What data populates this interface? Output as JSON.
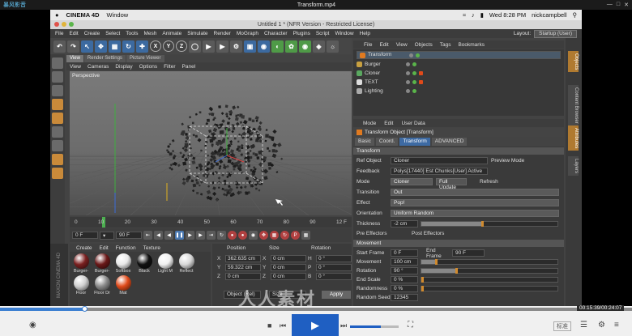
{
  "player": {
    "brand": "暴风影音",
    "title": "Transform.mp4",
    "window_controls": [
      "—",
      "□",
      "✕"
    ],
    "time": "00:15:39/00:24:07",
    "quality": "标准",
    "seek_progress": 0.133,
    "volume": 0.63
  },
  "mac_menu": {
    "app": "CINEMA 4D",
    "items": [
      "Window"
    ],
    "clock": "Wed 8:28 PM",
    "user": "nickcampbell"
  },
  "c4d": {
    "title": "Untitled 1 * (NFR Version - Restricted License)",
    "menu": [
      "File",
      "Edit",
      "Create",
      "Select",
      "Tools",
      "Mesh",
      "Animate",
      "Simulate",
      "Render",
      "MoGraph",
      "Character",
      "Plugins",
      "Script",
      "Window",
      "Help"
    ],
    "layout_label": "Layout:",
    "layout_value": "Startup (User)",
    "view_tabs": [
      "View",
      "Render Settings",
      "Picture Viewer"
    ],
    "view_menu": [
      "View",
      "Cameras",
      "Display",
      "Options",
      "Filter",
      "Panel"
    ],
    "viewport_label": "Perspective",
    "timeline_ticks": [
      "0",
      "10",
      "20",
      "30",
      "40",
      "50",
      "60",
      "70",
      "80",
      "90"
    ],
    "current_frame_marker": "12 F",
    "frame_start": "0 F",
    "frame_end": "90 F",
    "mat_menu": [
      "Create",
      "Edit",
      "Function",
      "Texture"
    ],
    "materials": [
      {
        "name": "Burger-",
        "color": "#7a2020"
      },
      {
        "name": "Burger-",
        "color": "#6a1818"
      },
      {
        "name": "Softbox",
        "color": "#e8e8e8"
      },
      {
        "name": "Black",
        "color": "#111111"
      },
      {
        "name": "Light M",
        "color": "#f0f0f0"
      },
      {
        "name": "Reflect",
        "color": "#d8d8d8"
      },
      {
        "name": "Floor",
        "color": "#cfcfcf"
      },
      {
        "name": "Floor Dr",
        "color": "#8a8a8a"
      },
      {
        "name": "Mat",
        "color": "#e04a1a"
      }
    ],
    "maxon_label": "MAXON CINEMA 4D",
    "coords": {
      "headers": [
        "Position",
        "Size",
        "Rotation"
      ],
      "rows": [
        {
          "axis": "X",
          "pos": "362.635 cm",
          "size_axis": "X",
          "size": "0 cm",
          "rot_axis": "H",
          "rot": "0 °"
        },
        {
          "axis": "Y",
          "pos": "59.322 cm",
          "size_axis": "Y",
          "size": "0 cm",
          "rot_axis": "P",
          "rot": "0 °"
        },
        {
          "axis": "Z",
          "pos": "0 cm",
          "size_axis": "Z",
          "size": "0 cm",
          "rot_axis": "B",
          "rot": "0 °"
        }
      ],
      "mode1": "Object (Rel)",
      "mode2": "Size",
      "apply": "Apply"
    },
    "obj_tabs": [
      "File",
      "Edit",
      "View",
      "Objects",
      "Tags",
      "Bookmarks"
    ],
    "objects": [
      {
        "name": "Transform",
        "color": "#e07a20"
      },
      {
        "name": "Burger",
        "color": "#c8a040"
      },
      {
        "name": "Cloner",
        "color": "#5aa860"
      },
      {
        "name": "TEXT",
        "color": "#ddd"
      },
      {
        "name": "Lighting",
        "color": "#aaa"
      }
    ],
    "attr_tabs": [
      "Mode",
      "Edit",
      "User Data"
    ],
    "attr_title": "Transform Object [Transform]",
    "attr_subtabs": [
      "Basic",
      "Coord.",
      "Transform",
      "ADVANCED"
    ],
    "transform_section": "Transform",
    "ref_object_label": "Ref Object",
    "ref_object": "Cloner",
    "preview_mode": "Preview Mode",
    "feedback_label": "Feedback",
    "feedback": "Polys[17440]  Est Chunks[User]  Active",
    "mode_label": "Mode",
    "mode": "Cloner",
    "full_update": "Full Update",
    "refresh": "Refresh",
    "transition_label": "Transition",
    "transition": "Out",
    "effect_label": "Effect",
    "effect": "Pop!",
    "orientation_label": "Orientation",
    "orientation": "Uniform Random",
    "thickness_label": "Thickness",
    "thickness": "-2 cm",
    "pre_effectors": "Pre Effectors",
    "post_effectors": "Post Effectors",
    "movement_section": "Movement",
    "start_frame_label": "Start Frame",
    "start_frame": "0 F",
    "end_frame_label": "End Frame",
    "end_frame": "90 F",
    "movement_label": "Movement",
    "movement": "100 cm",
    "rotation_label": "Rotation",
    "rotation": "90 °",
    "end_scale_label": "End Scale",
    "end_scale": "0 %",
    "randomness_label": "Randomness",
    "randomness": "0 %",
    "random_seed_label": "Random Seed",
    "random_seed": "12345",
    "right_tabs": [
      "Objects",
      "Content Browser",
      "Attributes",
      "Layers"
    ],
    "watermark": "人人素材"
  }
}
